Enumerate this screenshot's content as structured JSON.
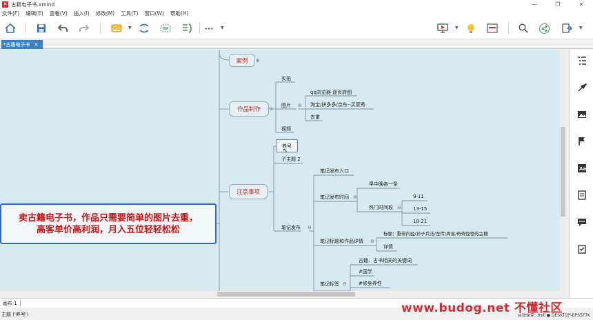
{
  "window": {
    "title": "古籍电子书.xmind",
    "controls": [
      "—",
      "❐",
      "✕"
    ]
  },
  "menu": [
    "文件(F)",
    "编辑(E)",
    "查看(V)",
    "插入(I)",
    "修改(M)",
    "工具(T)",
    "窗口(W)",
    "帮助(H)"
  ],
  "toolbar": {
    "icons": [
      "home-icon",
      "save-icon",
      "undo-icon",
      "redo-icon",
      "topic-style-icon",
      "relationship-icon",
      "boundary-icon",
      "summary-icon",
      "more-icon",
      "presentation-icon",
      "idea-icon",
      "layout-icon",
      "search-icon",
      "share-icon",
      "export-icon"
    ],
    "more_label": "···"
  },
  "tab": {
    "label": "*古籍电子书",
    "close": "✕"
  },
  "mindmap": {
    "topics": {
      "case": "案例",
      "works": "作品制作",
      "notes": "注意事项"
    },
    "works_children": {
      "shoot": "实拍",
      "image": "图片",
      "video": "视频"
    },
    "image_children": [
      "qq浏览器 逐页转图",
      "淘宝/拼多多/京东--买家秀",
      "去重"
    ],
    "notes_children": {
      "account": "养号",
      "subtopic": "子主题 2",
      "publish": "笔记发布"
    },
    "publish_children": {
      "entry": "笔记发布入口",
      "time": "笔记发布时间",
      "title": "笔记标题和作品详情",
      "tags": "笔记标签"
    },
    "time_children": {
      "daily": "早中晚各一条",
      "hot": "热门时间段"
    },
    "hot_times": [
      "9-11",
      "13-15",
      "18-21"
    ],
    "title_children": {
      "title_text": "标题：重带内经/孙子兵法/左传/周易/奇奇怪怪的古籍",
      "detail": "详情"
    },
    "tags_children": [
      "古籍、古书相关的关键词",
      "#国学",
      "#修身养性"
    ]
  },
  "banner": {
    "line1": "卖古籍电子书，作品只需要简单的图片去重，",
    "line2": "高客单价高利润，月入五位轻轻松松"
  },
  "sheet": {
    "name": "画布 1"
  },
  "status": {
    "left": "主题 ('养号')",
    "right": "自动保存: 关闭   ● DESKTOP-BP65F7K"
  },
  "watermark": "www.budog.net 不懂社区",
  "colors": {
    "accent": "#3b82c4",
    "canvas": "#d8eaf1",
    "banner_text": "#d01010",
    "banner_border": "#3366cc",
    "topic_text": "#b6382f",
    "connector": "#7a8fa3"
  }
}
